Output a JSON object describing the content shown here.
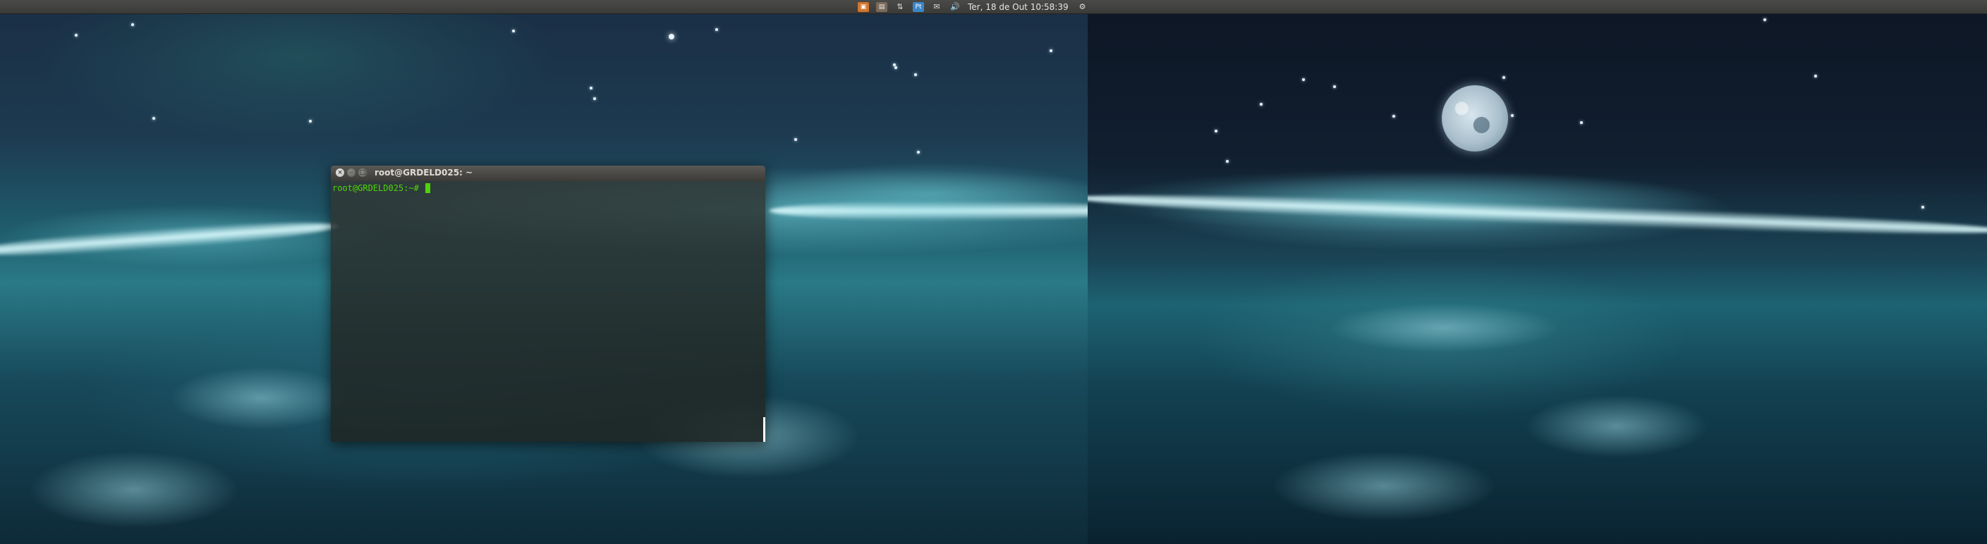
{
  "panel": {
    "indicators": [
      {
        "name": "app-launcher-icon",
        "glyph": "▣"
      },
      {
        "name": "briefcase-icon",
        "glyph": "▤"
      },
      {
        "name": "network-icon",
        "glyph": "⇅"
      },
      {
        "name": "keyboard-layout-icon",
        "glyph": "Pt"
      },
      {
        "name": "mail-icon",
        "glyph": "✉"
      },
      {
        "name": "volume-icon",
        "glyph": "🔊"
      }
    ],
    "clock": "Ter, 18 de Out 10:58:39",
    "settings_glyph": "⚙"
  },
  "terminal": {
    "title": "root@GRDELD025: ~",
    "close_glyph": "×",
    "minimize_glyph": "–",
    "maximize_glyph": "□",
    "prompt": "root@GRDELD025:~# "
  },
  "colors": {
    "prompt": "#4ed40a",
    "panel": "#3c3b37",
    "terminal_bg": "#2c3432"
  }
}
